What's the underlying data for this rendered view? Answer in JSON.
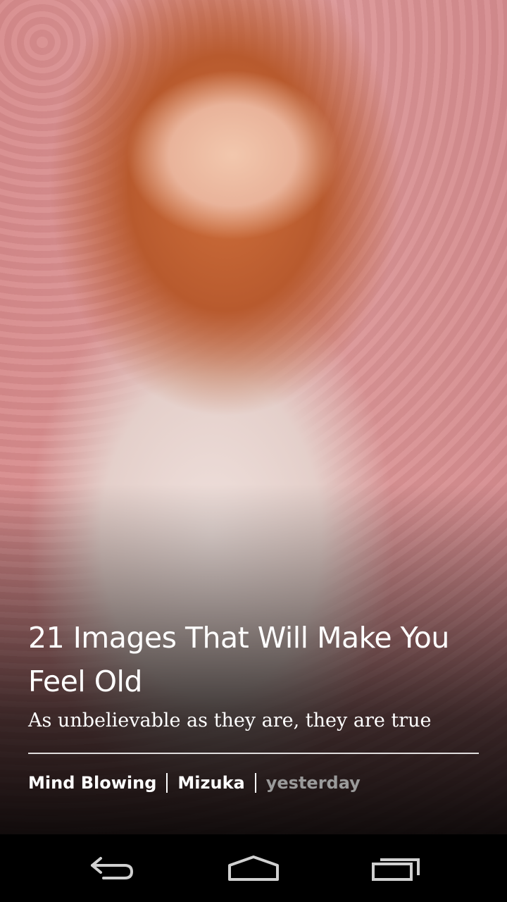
{
  "article": {
    "headline": "21 Images That Will Make You Feel Old",
    "subtitle": "As unbelievable as they are, they are true",
    "category": "Mind Blowing",
    "author": "Mizuka",
    "time": "yesterday"
  },
  "hero_image": {
    "icon": "photo-of-woman-with-red-hair"
  },
  "nav_bar": {
    "back_icon": "back-arrow-icon",
    "home_icon": "home-icon",
    "recents_icon": "recent-apps-icon"
  },
  "colors": {
    "text": "#ffffff",
    "meta_time": "#9a9a9a",
    "nav_background": "#000000",
    "nav_icon": "#d0d0d0"
  }
}
